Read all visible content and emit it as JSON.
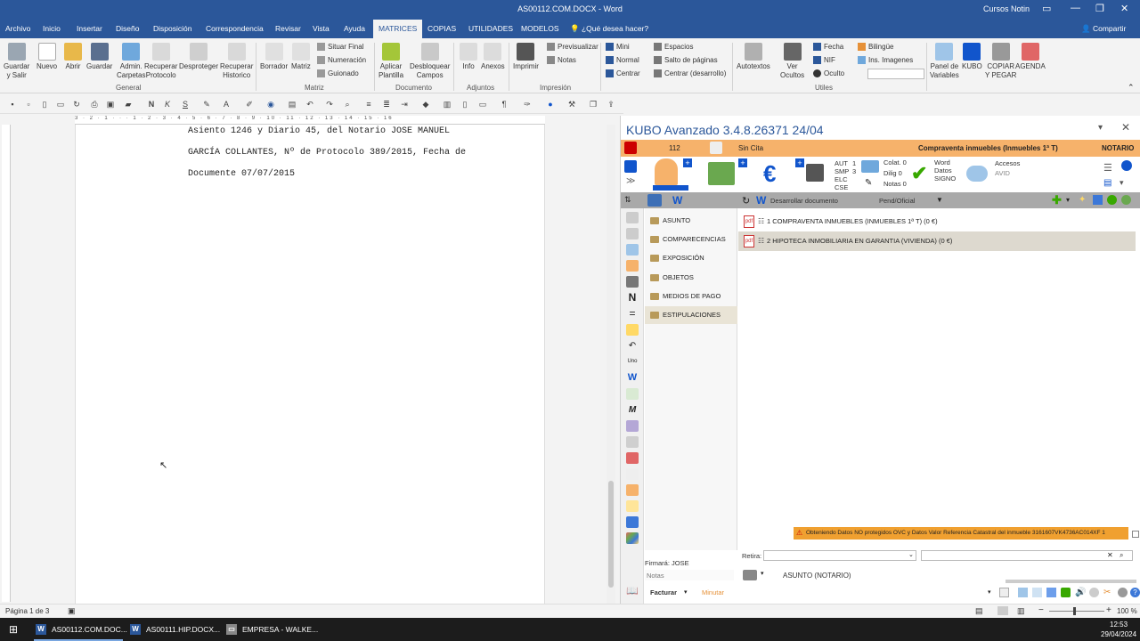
{
  "window": {
    "title": "AS00112.COM.DOCX  -  Word",
    "user": "Cursos Notin",
    "share_label": "Compartir"
  },
  "tabs": [
    {
      "label": "Archivo"
    },
    {
      "label": "Inicio"
    },
    {
      "label": "Insertar"
    },
    {
      "label": "Diseño"
    },
    {
      "label": "Disposición"
    },
    {
      "label": "Correspondencia"
    },
    {
      "label": "Revisar"
    },
    {
      "label": "Vista"
    },
    {
      "label": "Ayuda"
    },
    {
      "label": "MATRICES"
    },
    {
      "label": "COPIAS"
    },
    {
      "label": "UTILIDADES"
    },
    {
      "label": "MODELOS"
    },
    {
      "label": "¿Qué desea hacer?"
    }
  ],
  "ribbon": {
    "buttons": {
      "guardar_salir": "Guardar\ny Salir",
      "nuevo": "Nuevo",
      "abrir": "Abrir",
      "guardar": "Guardar",
      "admin_carpetas": "Admin.\nCarpetas",
      "recuperar_protocolo": "Recuperar\nProtocolo",
      "desproteger": "Desproteger",
      "recuperar_historico": "Recuperar\nHistorico",
      "borrador": "Borrador",
      "matriz": "Matriz",
      "aplicar_plantilla": "Aplicar\nPlantilla",
      "desbloquear_campos": "Desbloquear\nCampos",
      "info": "Info",
      "anexos": "Anexos",
      "imprimir": "Imprimir",
      "autotextos": "Autotextos",
      "ver_ocultos": "Ver\nOcultos",
      "panel_variables": "Panel de\nVariables",
      "kubo": "KUBO",
      "copiar_pegar": "COPIAR\nY PEGAR",
      "agenda": "AGENDA"
    },
    "small": {
      "situar_final": "Situar Final",
      "numeracion": "Numeración",
      "guionado": "Guionado",
      "previsualizar": "Previsualizar",
      "notas": "Notas",
      "mini": "Mini",
      "normal": "Normal",
      "centrar": "Centrar",
      "espacios": "Espacios",
      "salto_paginas": "Salto de páginas",
      "centrar_desarrollo": "Centrar (desarrollo)",
      "fecha": "Fecha",
      "nif": "NIF",
      "oculto": "Oculto",
      "bilingue": "Bilingüe",
      "ins_imagenes": "Ins. Imagenes"
    },
    "groups": {
      "general": "General",
      "matriz": "Matriz",
      "documento": "Documento",
      "adjuntos": "Adjuntos",
      "impresion": "Impresión",
      "utiles": "Utiles"
    }
  },
  "document": {
    "lines": [
      "Asiento 1246 y Diario 45, del Notario JOSE MANUEL",
      "GARCÍA COLLANTES, Nº de Protocolo 389/2015, Fecha de",
      "Documente 07/07/2015"
    ]
  },
  "ruler_text": "3 · 2 · 1 · · · 1 · 2 · 3 · 4 · 5 · 6 · 7 · 8 · 9 · 10 · 11 · 12 · 13 · 14 · 15 · 16",
  "kubo": {
    "title": "KUBO Avanzado 3.4.8.26371   24/04",
    "number": "112",
    "cita": "Sin Cita",
    "case_title": "Compraventa inmuebles (Inmuebles 1ª T)",
    "role": "NOTARIO",
    "info": {
      "aut": "AUT",
      "aut_n": "1",
      "smp": "SMP",
      "smp_n": "3",
      "elc": "ELC",
      "cse": "CSE",
      "colat": "Colat. 0",
      "dilig": "Dilig 0",
      "notas": "Notas 0",
      "word": "Word",
      "datos": "Datos",
      "signo": "SIGNO",
      "accesos": "Accesos",
      "avid": "AVID"
    },
    "toolbar": {
      "desarrollar": "Desarrollar documento",
      "pend": "Pend/Oficial"
    },
    "sections": [
      {
        "label": "ASUNTO"
      },
      {
        "label": "COMPARECENCIAS"
      },
      {
        "label": "EXPOSICIÓN"
      },
      {
        "label": "OBJETOS"
      },
      {
        "label": "MEDIOS DE PAGO"
      },
      {
        "label": "ESTIPULACIONES"
      }
    ],
    "documents": [
      {
        "label": "1 COMPRAVENTA INMUEBLES (INMUEBLES 1ª T) (0 €)"
      },
      {
        "label": "2 HIPOTECA INMOBILIARIA EN GARANTIA (VIVIENDA) (0 €)"
      }
    ],
    "warning": "Obteniendo Datos NO protegidos OVC y Datos Valor Referencia Catastral del inmueble 3161607VK4736AC014XF 1",
    "firmara": "Firmará: JOSE",
    "notas_placeholder": "Notas",
    "facturar": "Facturar",
    "minutar": "Minutar",
    "retira": "Retira:",
    "asunto_notario": "ASUNTO (NOTARIO)"
  },
  "status": {
    "page": "Página 1 de 3",
    "zoom": "100 %"
  },
  "taskbar": {
    "items": [
      {
        "label": "AS00112.COM.DOC..."
      },
      {
        "label": "AS00111.HIP.DOCX..."
      },
      {
        "label": "EMPRESA - WALKE..."
      }
    ],
    "time": "12:53",
    "date": "29/04/2024"
  }
}
